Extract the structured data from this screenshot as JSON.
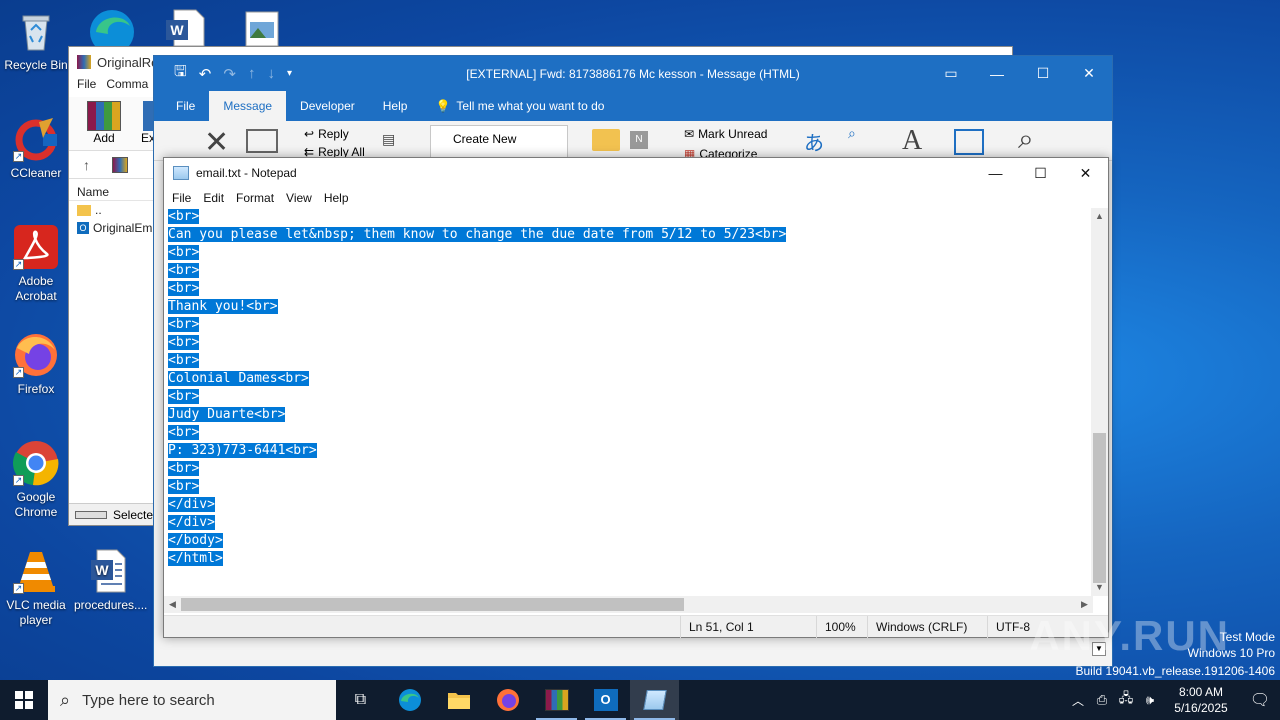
{
  "desktop": {
    "icons": [
      {
        "label": "Recycle Bin"
      },
      {
        "label": "CCleaner"
      },
      {
        "label": "Adobe Acrobat"
      },
      {
        "label": "Firefox"
      },
      {
        "label": "Google Chrome"
      },
      {
        "label": "VLC media player"
      },
      {
        "label": "procedures...."
      }
    ]
  },
  "winrar": {
    "title": "OriginalRe",
    "menu": [
      "File",
      "Comma"
    ],
    "toolbar": {
      "add": "Add",
      "extract": "Ex"
    },
    "column_name": "Name",
    "rows": [
      "..",
      "OriginalEm"
    ],
    "status": "Selecte"
  },
  "outlook": {
    "title": "[EXTERNAL] Fwd: 8173886176 Mc kesson  -  Message (HTML)",
    "tabs": [
      "File",
      "Message",
      "Developer",
      "Help"
    ],
    "active_tab": "Message",
    "tell_me": "Tell me what you want to do",
    "ribbon": {
      "reply": "Reply",
      "reply_all": "Reply All",
      "create_new": "Create New",
      "mark_unread": "Mark Unread",
      "categorize": "Categorize"
    }
  },
  "notepad": {
    "title": "email.txt - Notepad",
    "menu": [
      "File",
      "Edit",
      "Format",
      "View",
      "Help"
    ],
    "lines": [
      "<br>",
      "Can you please let&nbsp; them know to change the due date from 5/12 to 5/23<br>",
      "<br>",
      "<br>",
      "<br>",
      "Thank you!<br>",
      "<br>",
      "<br>",
      "<br>",
      "Colonial Dames<br>",
      "<br>",
      "Judy Duarte<br>",
      "<br>",
      "P: 323)773-6441<br>",
      "<br>",
      "<br>",
      "</div>",
      "</div>",
      "</body>",
      "</html>"
    ],
    "status": {
      "position": "Ln 51, Col 1",
      "zoom": "100%",
      "line_ending": "Windows (CRLF)",
      "encoding": "UTF-8"
    }
  },
  "watermark": {
    "brand": "ANY.RUN",
    "mode": "Test Mode",
    "os": "Windows 10 Pro",
    "build": "Build 19041.vb_release.191206-1406"
  },
  "taskbar": {
    "search_placeholder": "Type here to search",
    "time": "8:00 AM",
    "date": "5/16/2025"
  }
}
